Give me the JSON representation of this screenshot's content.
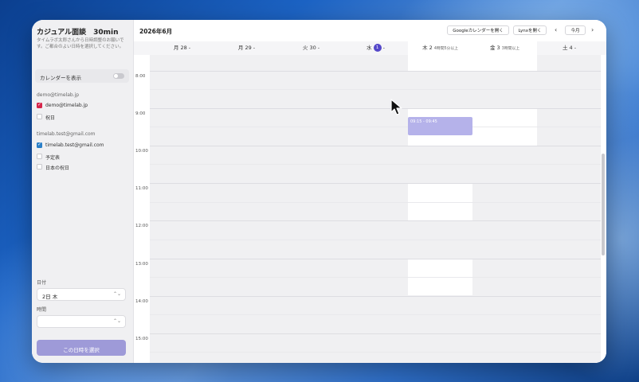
{
  "sidebar": {
    "title": "カジュアル面談　30min",
    "description": "タイムラボ太郎さんから日時調整のお願いです。ご都合のよい日時を選択してください。",
    "show_calendar_label": "カレンダーを表示",
    "accounts": [
      {
        "email": "demo@timelab.jp",
        "calendars": [
          {
            "label": "demo@timelab.jp",
            "checked": true,
            "color": "#d6254a"
          },
          {
            "label": "祝日",
            "checked": false,
            "color": "#ffffff"
          }
        ]
      },
      {
        "email": "timelab.test@gmail.com",
        "calendars": [
          {
            "label": "timelab.test@gmail.com",
            "checked": true,
            "color": "#2a7fc8"
          },
          {
            "label": "予定表",
            "checked": false,
            "color": "#ffffff"
          },
          {
            "label": "日本の祝日",
            "checked": false,
            "color": "#ffffff"
          }
        ]
      }
    ],
    "date_label": "日付",
    "date_value": "2日 木",
    "time_label": "時間",
    "time_value": "",
    "submit_label": "この日時を選択"
  },
  "toolbar": {
    "month": "2026年6月",
    "google_button": "Googleカレンダーを開く",
    "lynx_button": "Lynxを開く",
    "today_button": "今月",
    "prev_icon": "chevron-left-icon",
    "next_icon": "chevron-right-icon"
  },
  "days": [
    {
      "label": "月 28 -",
      "sub": "",
      "highlight": false
    },
    {
      "label": "月 29 -",
      "sub": "",
      "highlight": false
    },
    {
      "label": "火 30 -",
      "sub": "",
      "highlight": false
    },
    {
      "label": "水",
      "badge": "1",
      "suffix": " -",
      "sub": "",
      "highlight": false
    },
    {
      "label": "木 2",
      "sub": "4時間5分以上",
      "highlight": true
    },
    {
      "label": "金 3",
      "sub": "3時間以上",
      "highlight": true
    },
    {
      "label": "土 4 -",
      "sub": "",
      "highlight": false
    }
  ],
  "times": [
    "8:00",
    "9:00",
    "10:00",
    "11:00",
    "12:00",
    "13:00",
    "14:00",
    "15:00"
  ],
  "event": {
    "label": "09:15 - 09:45"
  },
  "colors": {
    "accent": "#5447c9",
    "event": "#b5b2ea",
    "submit": "#9e9ad8"
  }
}
